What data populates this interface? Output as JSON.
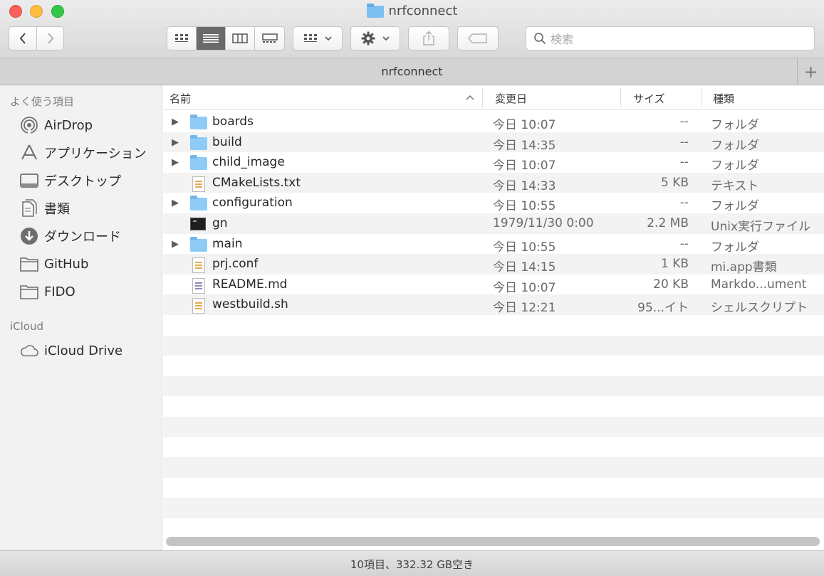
{
  "window": {
    "title": "nrfconnect"
  },
  "toolbar": {
    "back_icon": "chevron-left-icon",
    "forward_icon": "chevron-right-icon",
    "view_modes": [
      "icon-view",
      "list-view",
      "column-view",
      "gallery-view"
    ],
    "active_view": "list-view",
    "search_placeholder": "検索"
  },
  "tab": {
    "label": "nrfconnect",
    "add_icon": "plus-icon"
  },
  "sidebar": {
    "favorites_heading": "よく使う項目",
    "favorites": [
      {
        "label": "AirDrop",
        "icon": "airdrop-icon"
      },
      {
        "label": "アプリケーション",
        "icon": "applications-icon"
      },
      {
        "label": "デスクトップ",
        "icon": "desktop-icon"
      },
      {
        "label": "書類",
        "icon": "documents-icon"
      },
      {
        "label": "ダウンロード",
        "icon": "downloads-icon"
      },
      {
        "label": "GitHub",
        "icon": "folder-icon"
      },
      {
        "label": "FIDO",
        "icon": "folder-icon"
      }
    ],
    "icloud_heading": "iCloud",
    "icloud": [
      {
        "label": "iCloud Drive",
        "icon": "cloud-icon"
      }
    ]
  },
  "columns": {
    "name": "名前",
    "modified": "変更日",
    "size": "サイズ",
    "kind": "種類"
  },
  "files": [
    {
      "name": "boards",
      "modified": "今日 10:07",
      "size": "--",
      "kind": "フォルダ",
      "type": "folder"
    },
    {
      "name": "build",
      "modified": "今日 14:35",
      "size": "--",
      "kind": "フォルダ",
      "type": "folder"
    },
    {
      "name": "child_image",
      "modified": "今日 10:07",
      "size": "--",
      "kind": "フォルダ",
      "type": "folder"
    },
    {
      "name": "CMakeLists.txt",
      "modified": "今日 14:33",
      "size": "5 KB",
      "kind": "テキスト",
      "type": "text"
    },
    {
      "name": "configuration",
      "modified": "今日 10:55",
      "size": "--",
      "kind": "フォルダ",
      "type": "folder"
    },
    {
      "name": "gn",
      "modified": "1979/11/30 0:00",
      "size": "2.2 MB",
      "kind": "Unix実行ファイル",
      "type": "exec"
    },
    {
      "name": "main",
      "modified": "今日 10:55",
      "size": "--",
      "kind": "フォルダ",
      "type": "folder"
    },
    {
      "name": "prj.conf",
      "modified": "今日 14:15",
      "size": "1 KB",
      "kind": "mi.app書類",
      "type": "text"
    },
    {
      "name": "README.md",
      "modified": "今日 10:07",
      "size": "20 KB",
      "kind": "Markdo...ument",
      "type": "markdown"
    },
    {
      "name": "westbuild.sh",
      "modified": "今日 12:21",
      "size": "95...イト",
      "kind": "シェルスクリプト",
      "type": "text"
    }
  ],
  "status": {
    "text": "10項目、332.32 GB空き"
  }
}
